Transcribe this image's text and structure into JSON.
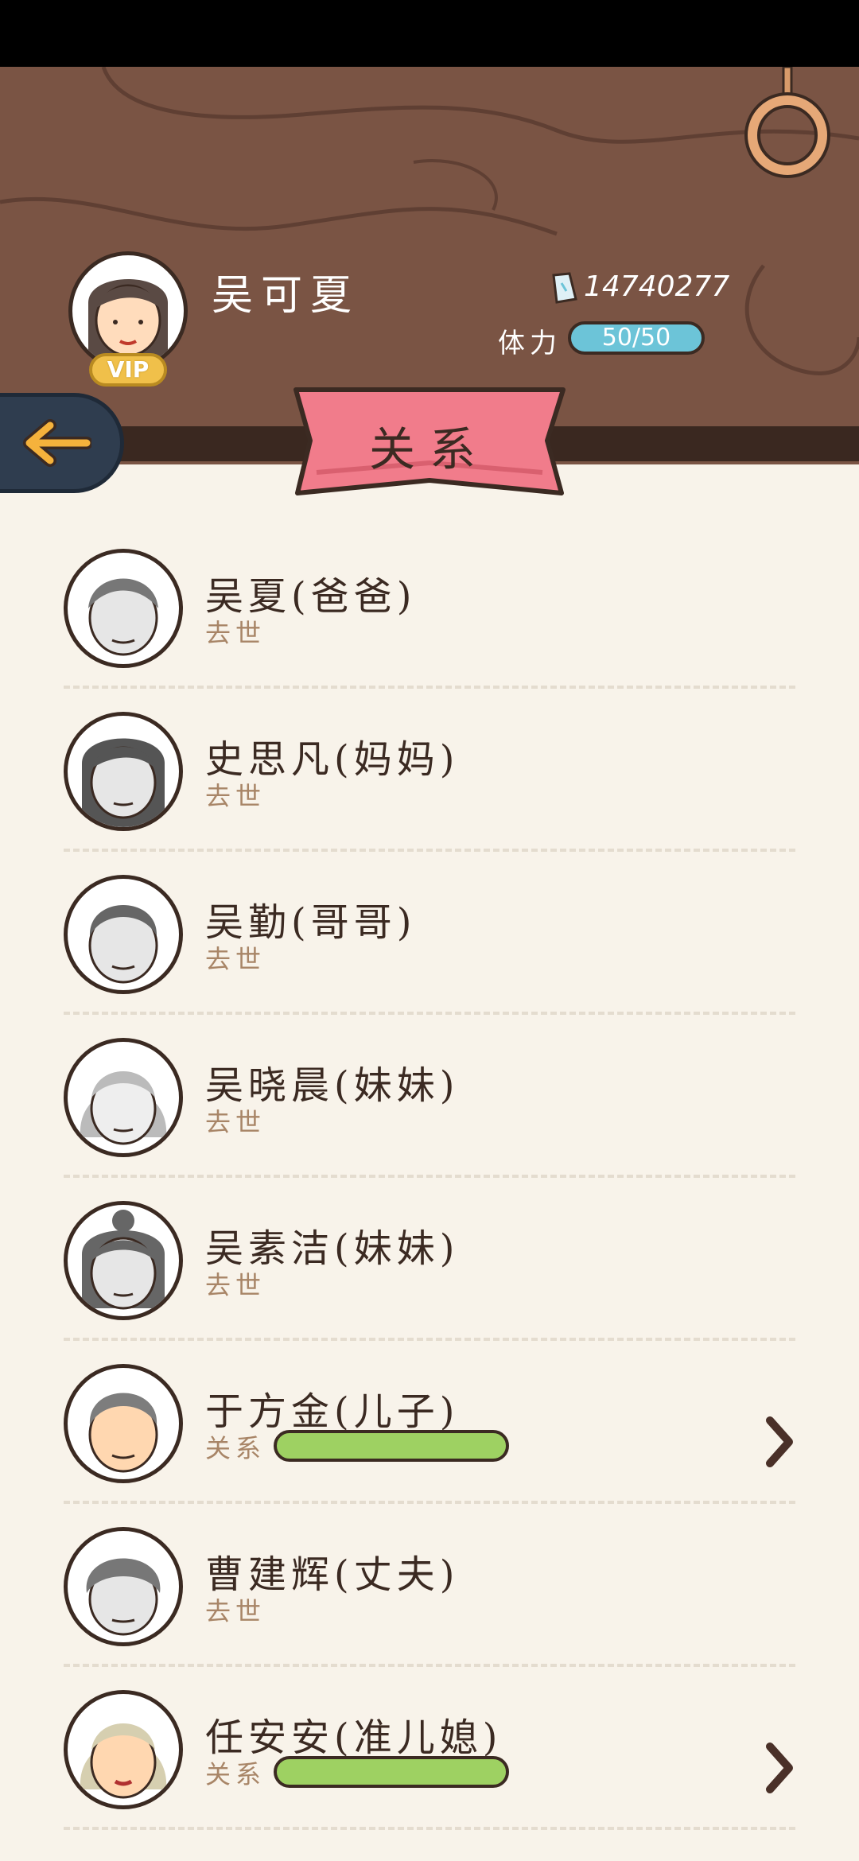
{
  "header": {
    "player_name": "吴可夏",
    "vip_label": "VIP",
    "money": "14740277",
    "stamina_label": "体力",
    "stamina_value": "50/50"
  },
  "title": "关系",
  "icons": {
    "back": "back-arrow-icon",
    "money": "money-note-icon",
    "hanger": "hanger-ring-icon",
    "chevron": "chevron-right-icon"
  },
  "colors": {
    "wood": "#7a5444",
    "ribbon": "#f17c8b",
    "relationship_bar": "#9ed162",
    "stamina_bar": "#6cc4d8"
  },
  "relations": [
    {
      "name": "吴夏(爸爸)",
      "status": "去世",
      "deceased": true
    },
    {
      "name": "史思凡(妈妈)",
      "status": "去世",
      "deceased": true
    },
    {
      "name": "吴勤(哥哥)",
      "status": "去世",
      "deceased": true
    },
    {
      "name": "吴晓晨(妹妹)",
      "status": "去世",
      "deceased": true
    },
    {
      "name": "吴素洁(妹妹)",
      "status": "去世",
      "deceased": true
    },
    {
      "name": "于方金(儿子)",
      "status": "关系",
      "deceased": false,
      "relationship_level": 1.0
    },
    {
      "name": "曹建辉(丈夫)",
      "status": "去世",
      "deceased": true
    },
    {
      "name": "任安安(准儿媳)",
      "status": "关系",
      "deceased": false,
      "relationship_level": 1.0
    }
  ]
}
